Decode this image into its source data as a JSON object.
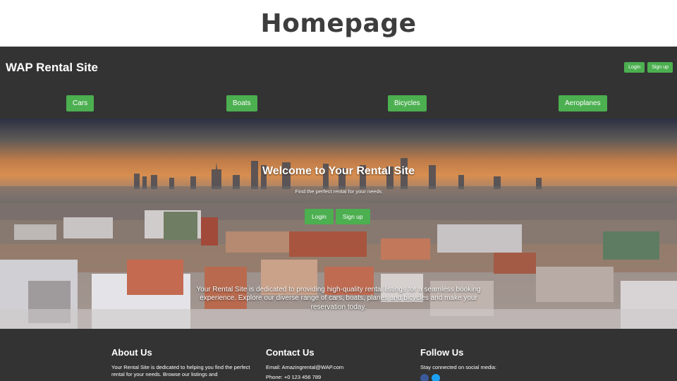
{
  "slide": {
    "title": "Homepage"
  },
  "header": {
    "brand": "WAP Rental Site",
    "login_label": "Login",
    "signup_label": "Sign up"
  },
  "nav": {
    "items": [
      {
        "label": "Cars"
      },
      {
        "label": "Boats"
      },
      {
        "label": "Bicycles"
      },
      {
        "label": "Aeroplanes"
      }
    ]
  },
  "hero": {
    "title": "Welcome to Your Rental Site",
    "subtitle": "Find the perfect rental for your needs",
    "login_label": "Login",
    "signup_label": "Sign up",
    "description": "Your Rental Site is dedicated to providing high-quality rental listings for a seamless booking experience. Explore our diverse range of cars, boats, planes and bicycles and make your reservation today."
  },
  "footer": {
    "about": {
      "heading": "About Us",
      "text": "Your Rental Site is dedicated to helping you find the perfect rental for your needs. Browse our listings and"
    },
    "contact": {
      "heading": "Contact Us",
      "email": "Email: Amazingrental@WAP.com",
      "phone": "Phone: +0 123 456 789"
    },
    "follow": {
      "heading": "Follow Us",
      "text": "Stay connected on social media:",
      "icons": [
        "facebook-icon",
        "twitter-icon"
      ]
    }
  },
  "colors": {
    "background": "#333333",
    "accent": "#4caf50",
    "text": "#ffffff",
    "slide_title": "#3d3d3d"
  }
}
